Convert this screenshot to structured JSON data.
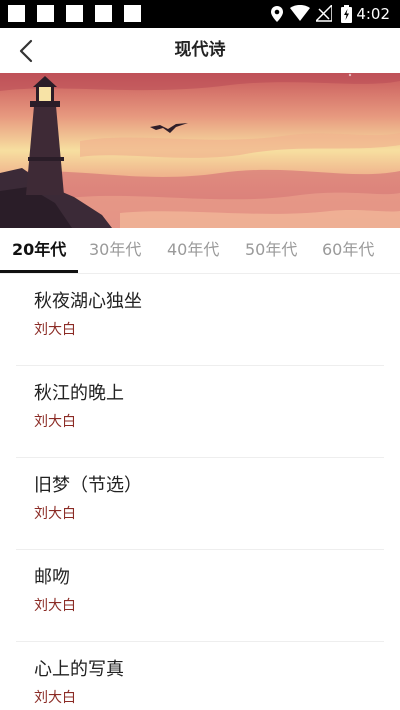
{
  "status_bar": {
    "time": "4:02"
  },
  "header": {
    "title": "现代诗"
  },
  "tabs": [
    {
      "label": "20年代",
      "active": true
    },
    {
      "label": "30年代",
      "active": false
    },
    {
      "label": "40年代",
      "active": false
    },
    {
      "label": "50年代",
      "active": false
    },
    {
      "label": "60年代",
      "active": false
    }
  ],
  "poems": [
    {
      "title": "秋夜湖心独坐",
      "author": "刘大白"
    },
    {
      "title": "秋江的晚上",
      "author": "刘大白"
    },
    {
      "title": "旧梦（节选）",
      "author": "刘大白"
    },
    {
      "title": "邮吻",
      "author": "刘大白"
    },
    {
      "title": "心上的写真",
      "author": "刘大白"
    }
  ],
  "colors": {
    "author": "#8b2b25",
    "active_tab": "#111111",
    "inactive_tab": "#9a9a9a",
    "status_bar": "#000000"
  },
  "icons": [
    "back-arrow-icon",
    "location-icon",
    "wifi-icon",
    "signal-icon",
    "battery-icon"
  ]
}
